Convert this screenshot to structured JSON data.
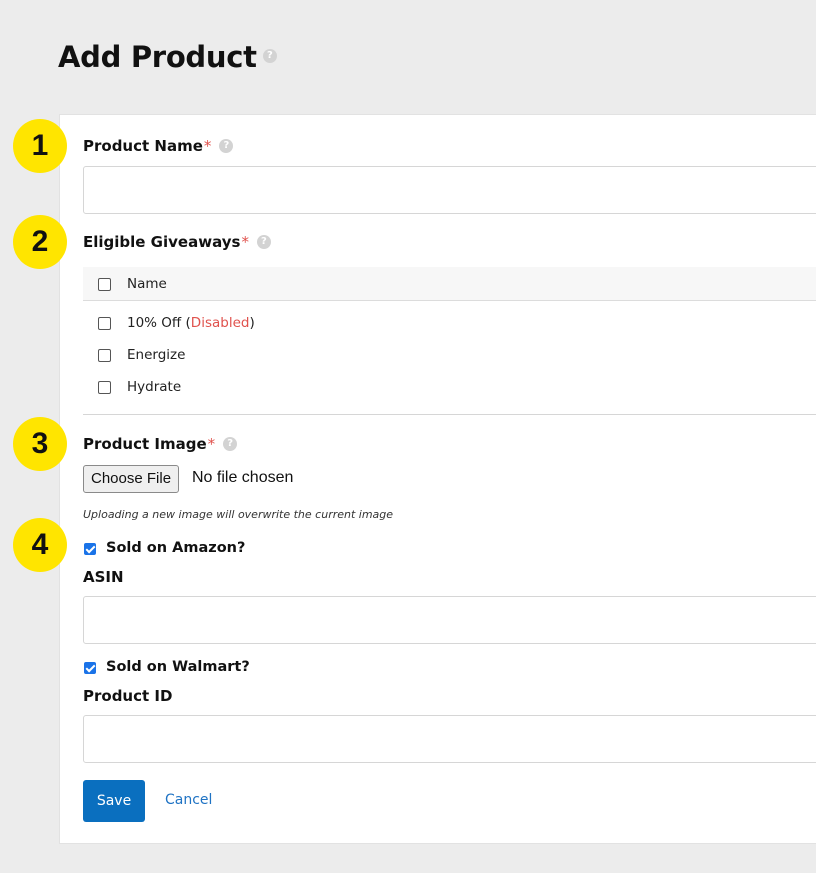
{
  "page": {
    "title": "Add Product",
    "help_glyph": "?"
  },
  "steps": [
    "1",
    "2",
    "3",
    "4"
  ],
  "product_name": {
    "label": "Product Name",
    "required_mark": "*",
    "value": ""
  },
  "giveaways": {
    "label": "Eligible Giveaways",
    "required_mark": "*",
    "column_header": "Name",
    "items": [
      {
        "name": "10% Off (",
        "status": "Disabled",
        "suffix": ")",
        "checked": false
      },
      {
        "name": "Energize",
        "checked": false
      },
      {
        "name": "Hydrate",
        "checked": false
      }
    ]
  },
  "product_image": {
    "label": "Product Image",
    "required_mark": "*",
    "button_label": "Choose File",
    "status": "No file chosen",
    "hint": "Uploading a new image will overwrite the current image"
  },
  "amazon": {
    "checkbox_label": "Sold on Amazon?",
    "checked": true,
    "field_label": "ASIN",
    "value": ""
  },
  "walmart": {
    "checkbox_label": "Sold on Walmart?",
    "checked": true,
    "field_label": "Product ID",
    "value": ""
  },
  "actions": {
    "save_label": "Save",
    "cancel_label": "Cancel"
  },
  "colors": {
    "step_badge": "#ffe500",
    "required": "#e0524d",
    "primary": "#0a6fbf",
    "link": "#1f73c4",
    "checkbox": "#1a73e8"
  }
}
